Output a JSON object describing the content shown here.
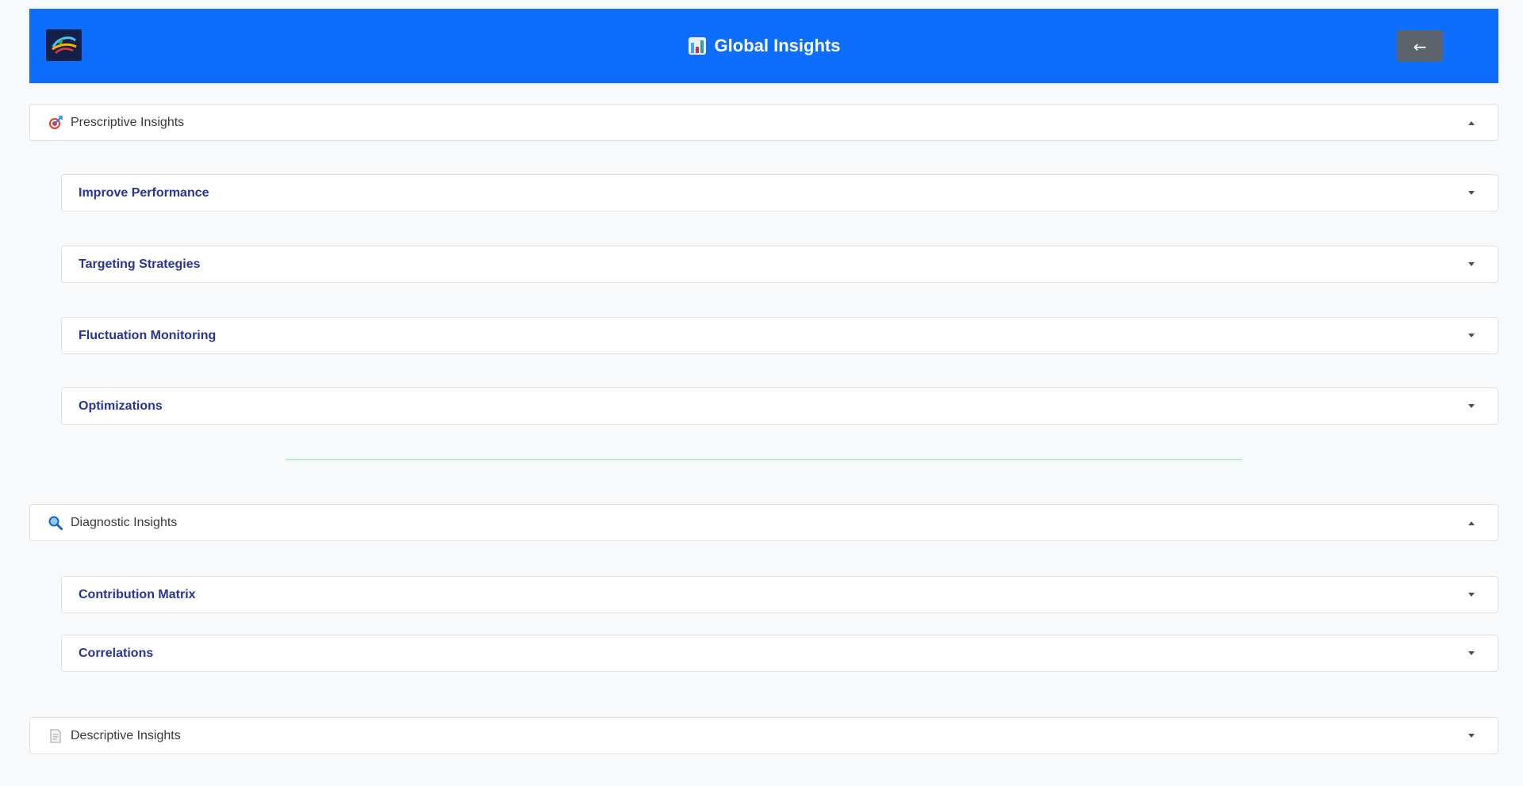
{
  "header": {
    "title": "Global Insights",
    "title_icon": "bar-chart-icon",
    "back_label": "←",
    "logo_icon": "brand-logo-icon",
    "bg_color": "#0d6efd"
  },
  "sections": {
    "prescriptive": {
      "label": "Prescriptive Insights",
      "icon": "target-icon",
      "expanded": true,
      "items": [
        {
          "label": "Improve Performance"
        },
        {
          "label": "Targeting Strategies"
        },
        {
          "label": "Fluctuation Monitoring"
        },
        {
          "label": "Optimizations"
        }
      ]
    },
    "diagnostic": {
      "label": "Diagnostic Insights",
      "icon": "magnifier-icon",
      "expanded": true,
      "items": [
        {
          "label": "Contribution Matrix"
        },
        {
          "label": "Correlations"
        }
      ]
    },
    "descriptive": {
      "label": "Descriptive Insights",
      "icon": "document-icon",
      "expanded": false
    }
  },
  "colors": {
    "sub_label": "#283593",
    "divider": "#b8ecd8"
  }
}
